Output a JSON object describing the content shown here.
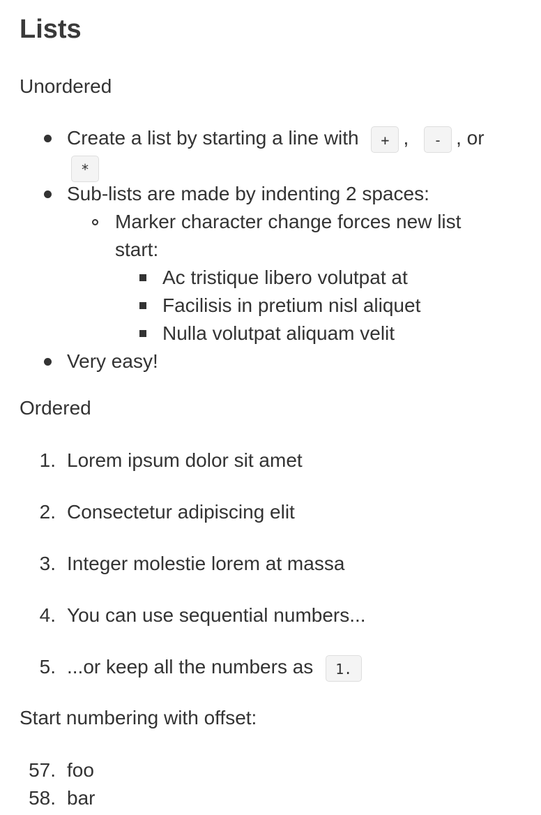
{
  "heading": "Lists",
  "unordered": {
    "label": "Unordered",
    "item1": {
      "text_before": "Create a list by starting a line with",
      "code_plus": "+",
      "sep1": ",",
      "code_minus": "-",
      "sep2": ", or",
      "code_star": "*"
    },
    "item2": {
      "text": "Sub-lists are made by indenting 2 spaces:",
      "sub": {
        "line1": "Marker character change forces new list",
        "line2": "start:",
        "items": [
          "Ac tristique libero volutpat at",
          "Facilisis in pretium nisl aliquet",
          "Nulla volutpat aliquam velit"
        ]
      }
    },
    "item3": "Very easy!"
  },
  "ordered": {
    "label": "Ordered",
    "items": [
      {
        "num": "1.",
        "text": "Lorem ipsum dolor sit amet"
      },
      {
        "num": "2.",
        "text": "Consectetur adipiscing elit"
      },
      {
        "num": "3.",
        "text": "Integer molestie lorem at massa"
      },
      {
        "num": "4.",
        "text": "You can use sequential numbers..."
      },
      {
        "num": "5.",
        "text": "...or keep all the numbers as",
        "code": "1."
      }
    ]
  },
  "offset": {
    "label": "Start numbering with offset:",
    "items": [
      {
        "num": "57.",
        "text": "foo"
      },
      {
        "num": "58.",
        "text": "bar"
      }
    ]
  }
}
